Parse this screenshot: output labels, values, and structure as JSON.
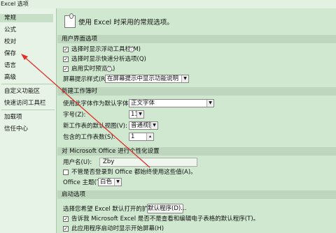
{
  "window": {
    "title": "Excel 选项"
  },
  "sidebar": {
    "items": [
      {
        "label": "常规"
      },
      {
        "label": "公式"
      },
      {
        "label": "校对"
      },
      {
        "label": "保存"
      },
      {
        "label": "语言"
      },
      {
        "label": "高级"
      },
      {
        "label": "自定义功能区"
      },
      {
        "label": "快速访问工具栏"
      },
      {
        "label": "加载项"
      },
      {
        "label": "信任中心"
      }
    ]
  },
  "main": {
    "header": "使用 Excel 时采用的常规选项。",
    "ui_section": {
      "title": "用户界面选项",
      "options": [
        {
          "label": "选择时显示浮动工具栏(M)",
          "checked": true
        },
        {
          "label": "选择时显示快速分析选项(Q)",
          "checked": true
        },
        {
          "label": "启用实时预览(L)",
          "checked": true
        }
      ],
      "tooltip_style": {
        "label": "屏幕提示样式(R):",
        "value": "在屏幕提示中显示功能说明"
      }
    },
    "new_workbook_section": {
      "title": "新建工作簿时",
      "font": {
        "label": "使用此字体作为默认字体(N):",
        "value": "正文字体"
      },
      "size": {
        "label": "字号(Z):",
        "value": "11"
      },
      "view": {
        "label": "新工作表的默认视图(V):",
        "value": "普通视图"
      },
      "sheets": {
        "label": "包含的工作表数(S):",
        "value": "1"
      }
    },
    "personalize_section": {
      "title": "对 Microsoft Office 进行个性化设置",
      "username": {
        "label": "用户名(U):",
        "value": "Zby"
      },
      "always_use": {
        "label": "不管是否登录到 Office 都始终使用这些值(A)。",
        "checked": false
      },
      "theme": {
        "label": "Office 主题(T):",
        "value": "白色"
      }
    },
    "startup_section": {
      "title": "启动选项",
      "default_programs": {
        "label": "选择您希望 Excel 默认打开的扩展名:",
        "button": "默认程序(D)..."
      },
      "options": [
        {
          "label": "告诉我 Microsoft Excel 是否不是查看和编辑电子表格的默认程序(T)。",
          "checked": true
        },
        {
          "label": "此应用程序启动时显示开始屏幕(H)",
          "checked": true
        }
      ]
    }
  },
  "colors": {
    "annotation_arrow": "#e0302a"
  }
}
